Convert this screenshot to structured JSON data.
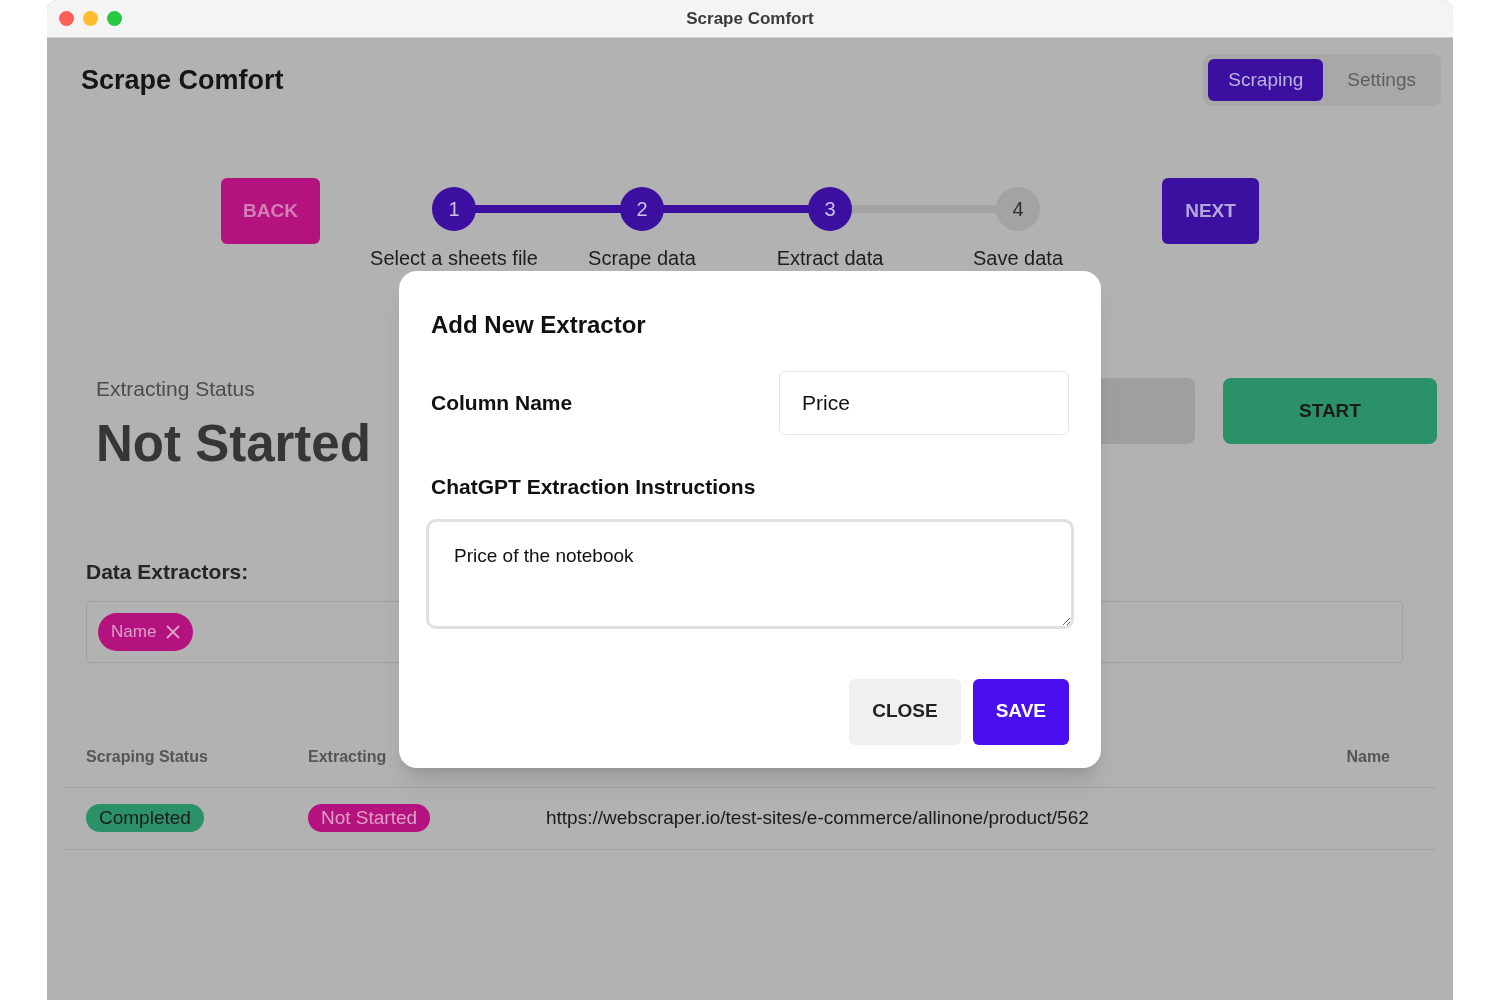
{
  "window": {
    "title": "Scrape Comfort"
  },
  "app_title": "Scrape Comfort",
  "tabs": [
    {
      "label": "Scraping",
      "selected": true
    },
    {
      "label": "Settings",
      "selected": false
    }
  ],
  "back_button": "BACK",
  "next_button": "NEXT",
  "steps": [
    {
      "number": "1",
      "label": "Select a sheets file",
      "completed": true
    },
    {
      "number": "2",
      "label": "Scrape data",
      "completed": true
    },
    {
      "number": "3",
      "label": "Extract data",
      "completed": true
    },
    {
      "number": "4",
      "label": "Save data",
      "completed": false
    }
  ],
  "status": {
    "label": "Extracting Status",
    "value": "Not Started"
  },
  "start_button": "START",
  "extractors": {
    "label": "Data Extractors:",
    "chips": [
      {
        "label": "Name"
      }
    ]
  },
  "table": {
    "columns": [
      "Scraping Status",
      "Extracting",
      "",
      "Name"
    ],
    "rows": [
      {
        "scraping_status": "Completed",
        "extracting_status": "Not Started",
        "link": "https://webscraper.io/test-sites/e-commerce/allinone/product/562"
      }
    ]
  },
  "dialog": {
    "title": "Add New Extractor",
    "column_label": "Column Name",
    "column_value": "Price",
    "instructions_label": "ChatGPT Extraction Instructions",
    "instructions_value": "Price of the notebook",
    "buttons": [
      {
        "label": "CLOSE",
        "kind": "secondary"
      },
      {
        "label": "SAVE",
        "kind": "primary"
      }
    ]
  }
}
